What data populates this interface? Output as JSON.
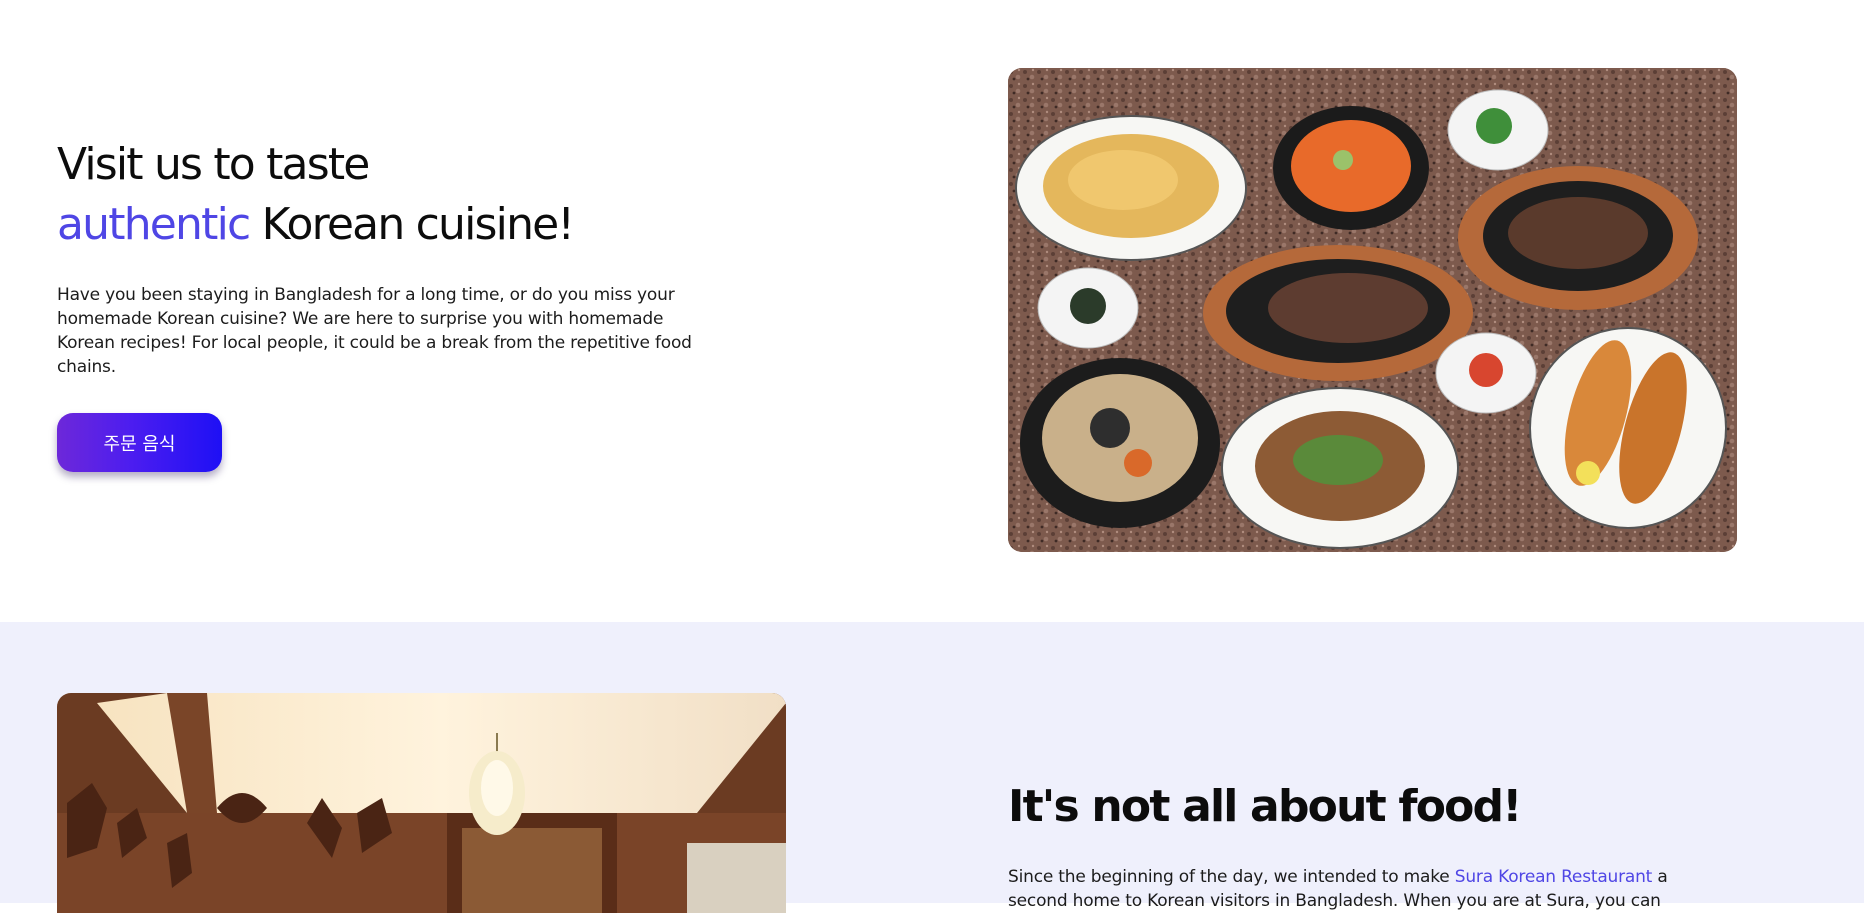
{
  "hero": {
    "title_line1": "Visit us to taste",
    "title_accent": "authentic",
    "title_line2_rest": " Korean cuisine!",
    "body": "Have you been staying in Bangladesh for a long time, or do you miss your homemade Korean cuisine? We are here to surprise you with homemade Korean recipes! For local people, it could be a break from the repetitive food chains.",
    "button_label": "주문 음식"
  },
  "about": {
    "title": "It's not all about food!",
    "body_start": "Since the beginning of the day, we intended to make ",
    "link_text": "Sura Korean Restaurant",
    "body_end": " a second home to Korean visitors in Bangladesh. When you are at Sura, you can"
  },
  "colors": {
    "accent": "#4f46e5",
    "section_bg": "#eff0fc",
    "button_gradient_start": "#6d28d9",
    "button_gradient_end": "#1e10f5"
  }
}
